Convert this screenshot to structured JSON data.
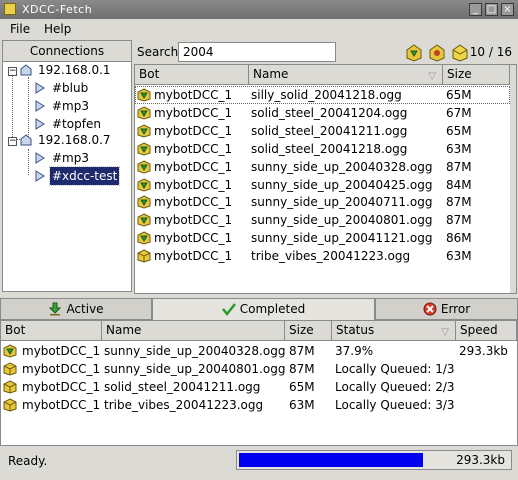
{
  "window": {
    "title": "XDCC-Fetch"
  },
  "menu": [
    {
      "label": "File"
    },
    {
      "label": "Help"
    }
  ],
  "connections": {
    "header": "Connections",
    "tree": [
      {
        "label": "192.168.0.1",
        "kind": "server",
        "expanded": true
      },
      {
        "label": "#blub",
        "kind": "channel"
      },
      {
        "label": "#mp3",
        "kind": "channel"
      },
      {
        "label": "#topfen",
        "kind": "channel"
      },
      {
        "label": "192.168.0.7",
        "kind": "server",
        "expanded": true
      },
      {
        "label": "#mp3",
        "kind": "channel"
      },
      {
        "label": "#xdcc-test",
        "kind": "channel",
        "selected": true
      }
    ]
  },
  "search": {
    "label": "Search",
    "value": "2004",
    "counter": "10 / 16"
  },
  "results": {
    "columns": [
      "Bot",
      "Name",
      "Size"
    ],
    "rows": [
      {
        "bot": "mybotDCC_1",
        "name": "silly_solid_20041218.ogg",
        "size": "65M",
        "icon": "green"
      },
      {
        "bot": "mybotDCC_1",
        "name": "solid_steel_20041204.ogg",
        "size": "67M",
        "icon": "green"
      },
      {
        "bot": "mybotDCC_1",
        "name": "solid_steel_20041211.ogg",
        "size": "65M",
        "icon": "green"
      },
      {
        "bot": "mybotDCC_1",
        "name": "solid_steel_20041218.ogg",
        "size": "63M",
        "icon": "green"
      },
      {
        "bot": "mybotDCC_1",
        "name": "sunny_side_up_20040328.ogg",
        "size": "87M",
        "icon": "green"
      },
      {
        "bot": "mybotDCC_1",
        "name": "sunny_side_up_20040425.ogg",
        "size": "84M",
        "icon": "green"
      },
      {
        "bot": "mybotDCC_1",
        "name": "sunny_side_up_20040711.ogg",
        "size": "87M",
        "icon": "green"
      },
      {
        "bot": "mybotDCC_1",
        "name": "sunny_side_up_20040801.ogg",
        "size": "87M",
        "icon": "green"
      },
      {
        "bot": "mybotDCC_1",
        "name": "sunny_side_up_20041121.ogg",
        "size": "86M",
        "icon": "green"
      },
      {
        "bot": "mybotDCC_1",
        "name": "tribe_vibes_20041223.ogg",
        "size": "63M",
        "icon": "yellow"
      }
    ]
  },
  "tabs": [
    {
      "label": "Active",
      "icon": "download-icon"
    },
    {
      "label": "Completed",
      "icon": "checkmark-icon"
    },
    {
      "label": "Error",
      "icon": "error-icon"
    }
  ],
  "queue": {
    "columns": [
      "Bot",
      "Name",
      "Size",
      "Status",
      "Speed"
    ],
    "rows": [
      {
        "bot": "mybotDCC_1",
        "name": "sunny_side_up_20040328.ogg",
        "size": "87M",
        "status": "37.9%",
        "speed": "293.3kb",
        "icon": "green"
      },
      {
        "bot": "mybotDCC_1",
        "name": "sunny_side_up_20040801.ogg",
        "size": "87M",
        "status": "Locally Queued:  1/3",
        "speed": "",
        "icon": "yellow"
      },
      {
        "bot": "mybotDCC_1",
        "name": "solid_steel_20041211.ogg",
        "size": "65M",
        "status": "Locally Queued:  2/3",
        "speed": "",
        "icon": "yellow"
      },
      {
        "bot": "mybotDCC_1",
        "name": "tribe_vibes_20041223.ogg",
        "size": "63M",
        "status": "Locally Queued:  3/3",
        "speed": "",
        "icon": "yellow"
      }
    ]
  },
  "status": {
    "text": "Ready.",
    "progress_fraction": 0.68,
    "speed": "293.3kb"
  },
  "colors": {
    "selection": "#1d2a6e",
    "progress": "#0000ee",
    "chrome": "#dcdad5"
  }
}
